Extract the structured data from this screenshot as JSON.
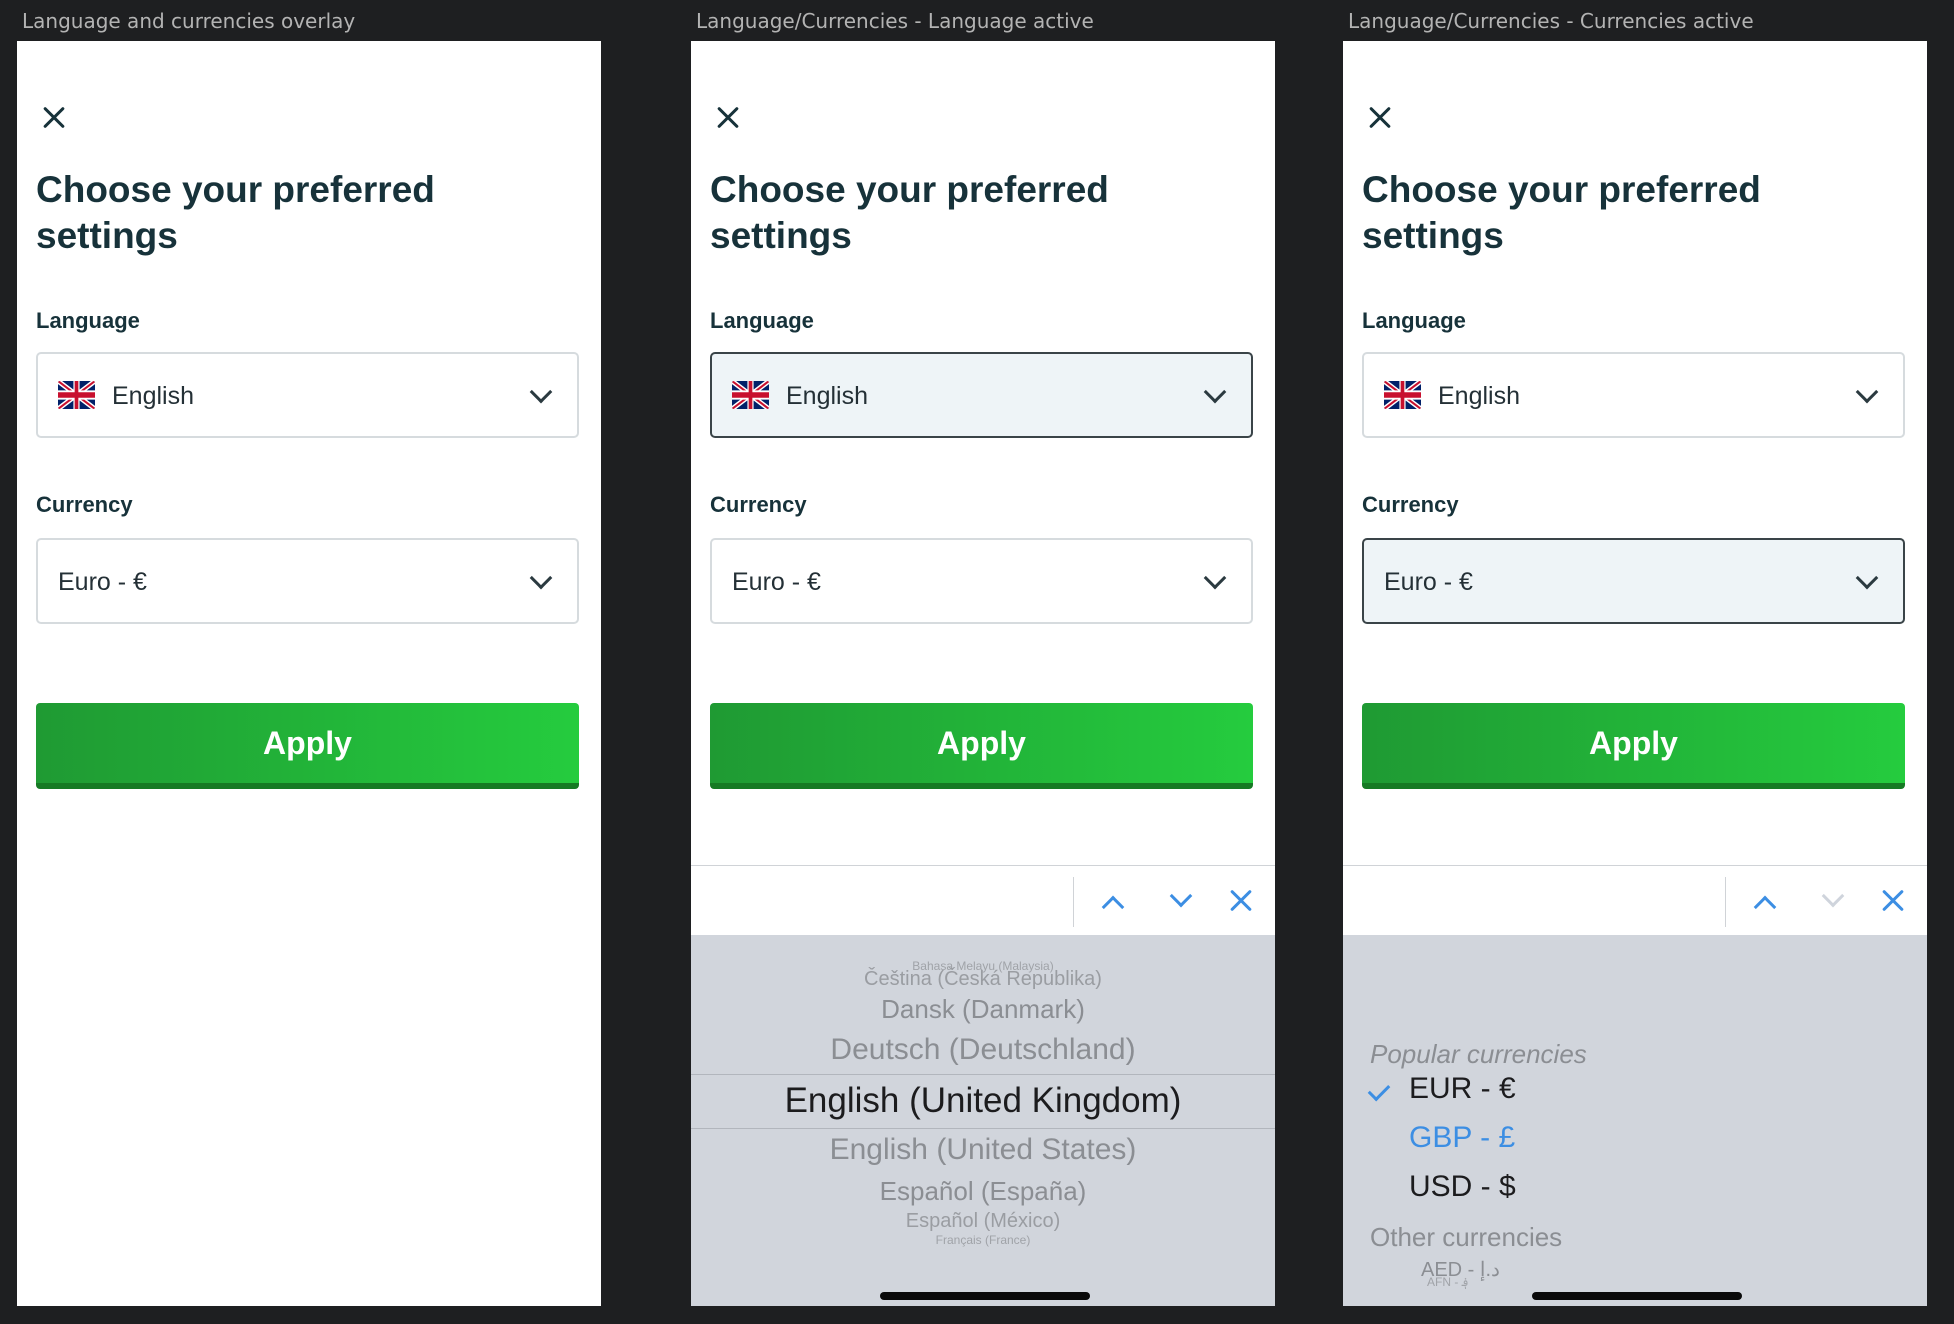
{
  "frames": [
    {
      "label": "Language and currencies overlay"
    },
    {
      "label": "Language/Currencies - Language active"
    },
    {
      "label": "Language/Currencies - Currencies active"
    }
  ],
  "dialog": {
    "title": "Choose your preferred settings",
    "language_label": "Language",
    "language_value": "English",
    "currency_label": "Currency",
    "currency_value": "Euro - €",
    "apply_label": "Apply"
  },
  "language_picker": {
    "options": [
      "Bahasa Melayu (Malaysia)",
      "Čeština (Česká Republika)",
      "Dansk (Danmark)",
      "Deutsch (Deutschland)",
      "English (United Kingdom)",
      "English (United States)",
      "Español (España)",
      "Español (México)",
      "Français (France)"
    ],
    "selected": "English (United Kingdom)"
  },
  "currency_picker": {
    "popular_label": "Popular currencies",
    "popular": [
      "EUR - €",
      "GBP - £",
      "USD - $"
    ],
    "selected": "GBP - £",
    "other_label": "Other currencies",
    "other": [
      "AED - د.إ",
      "AFN - ؋"
    ]
  },
  "colors": {
    "background": "#1e1f21",
    "heading": "#17323a",
    "apply_start": "#1f9a33",
    "apply_end": "#25cc3e",
    "active_field_bg": "#eef4f7",
    "picker_accent": "#3c8ee3",
    "wheel_bg": "#d1d5dc"
  },
  "icons": {
    "close": "close-icon",
    "dropdown": "chevron-down-icon",
    "flag": "uk-flag-icon",
    "nav_up": "chevron-up-icon",
    "nav_down": "chevron-down-icon",
    "check": "checkmark-icon"
  }
}
